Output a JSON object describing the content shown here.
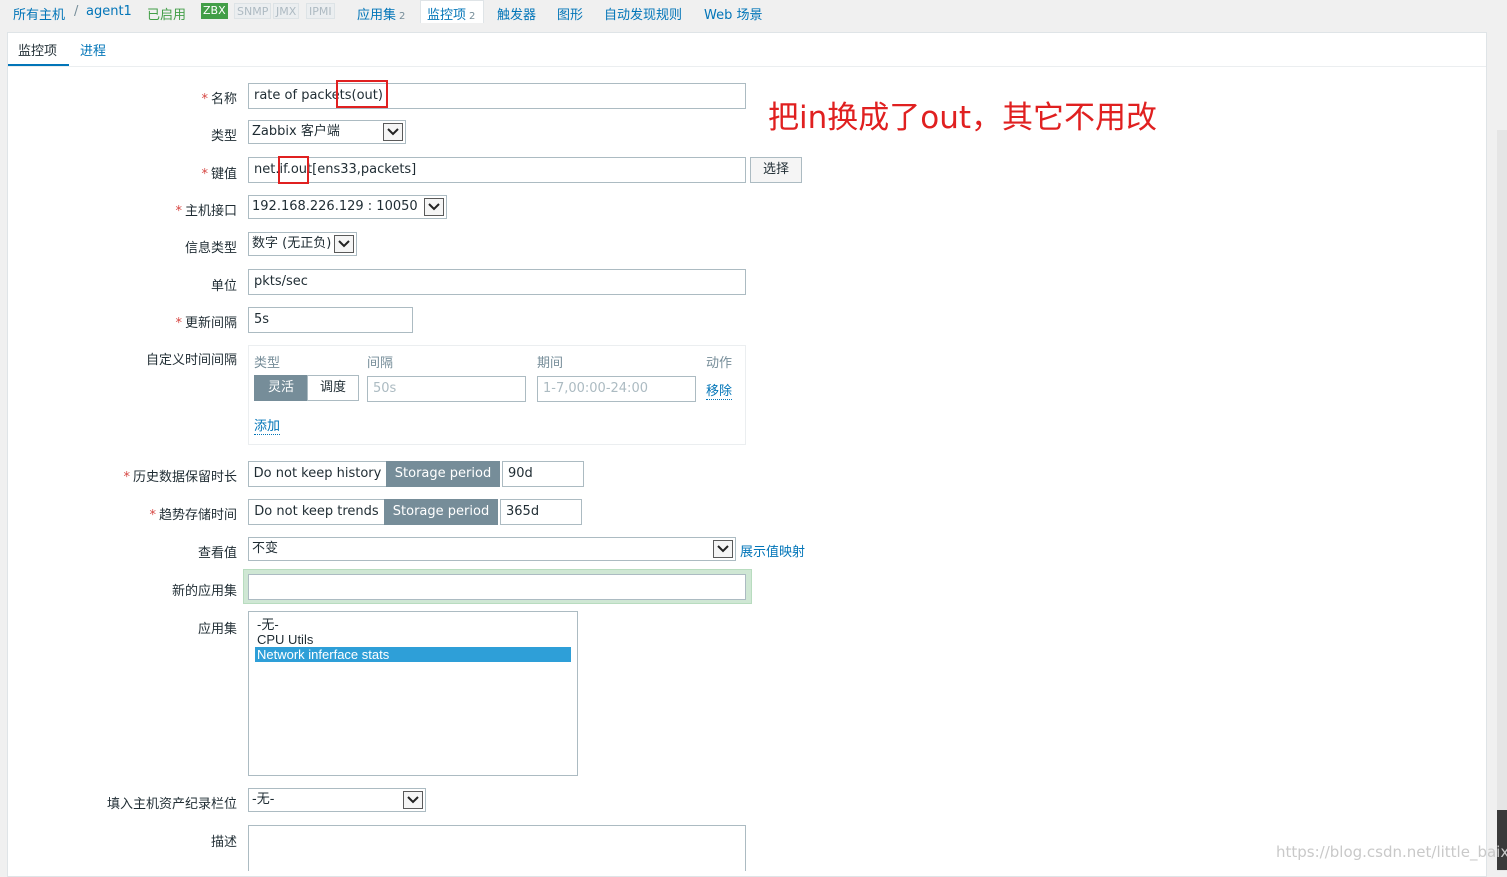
{
  "breadcrumb": {
    "all_hosts": "所有主机",
    "separator": "/",
    "host": "agent1",
    "status": "已启用",
    "badges": [
      "ZBX",
      "SNMP",
      "JMX",
      "IPMI"
    ],
    "links": [
      {
        "label": "应用集",
        "count": "2"
      },
      {
        "label": "监控项",
        "count": "2"
      },
      {
        "label": "触发器",
        "count": ""
      },
      {
        "label": "图形",
        "count": ""
      },
      {
        "label": "自动发现规则",
        "count": ""
      },
      {
        "label": "Web 场景",
        "count": ""
      }
    ]
  },
  "tabs": [
    "监控项",
    "进程"
  ],
  "form": {
    "name_label": "名称",
    "name_value": "rate of packets(out)",
    "type_label": "类型",
    "type_value": "Zabbix 客户端",
    "key_label": "键值",
    "key_value": "net.if.out[ens33,packets]",
    "select_button": "选择",
    "interface_label": "主机接口",
    "interface_value": "192.168.226.129 : 10050",
    "info_type_label": "信息类型",
    "info_type_value": "数字 (无正负)",
    "units_label": "单位",
    "units_value": "pkts/sec",
    "interval_label": "更新间隔",
    "interval_value": "5s",
    "custom_label": "自定义时间间隔",
    "custom": {
      "col_type": "类型",
      "col_interval": "间隔",
      "col_period": "期间",
      "col_action": "动作",
      "flexible": "灵活",
      "scheduling": "调度",
      "interval_placeholder": "50s",
      "period_placeholder": "1-7,00:00-24:00",
      "remove": "移除",
      "add": "添加"
    },
    "history_label": "历史数据保留时长",
    "history_no_keep": "Do not keep history",
    "history_storage": "Storage period",
    "history_value": "90d",
    "trends_label": "趋势存储时间",
    "trends_no_keep": "Do not keep trends",
    "trends_storage": "Storage period",
    "trends_value": "365d",
    "valuemap_label": "查看值",
    "valuemap_value": "不变",
    "valuemap_link": "展示值映射",
    "new_app_label": "新的应用集",
    "new_app_value": "",
    "apps_label": "应用集",
    "apps": [
      "-无-",
      "CPU Utils",
      "Network inferface stats"
    ],
    "apps_selected_index": 2,
    "inventory_label": "填入主机资产纪录栏位",
    "inventory_value": "-无-",
    "desc_label": "描述",
    "desc_value": ""
  },
  "annotation": "把in换成了out，其它不用改",
  "watermark": "https://blog.csdn.net/little_baixb",
  "colors": {
    "link": "#0275b8",
    "required": "#d64541",
    "annotation": "#e02020",
    "segment_active": "#768d99",
    "zbx_badge": "#429e47",
    "selected_row": "#2e9fd8"
  }
}
